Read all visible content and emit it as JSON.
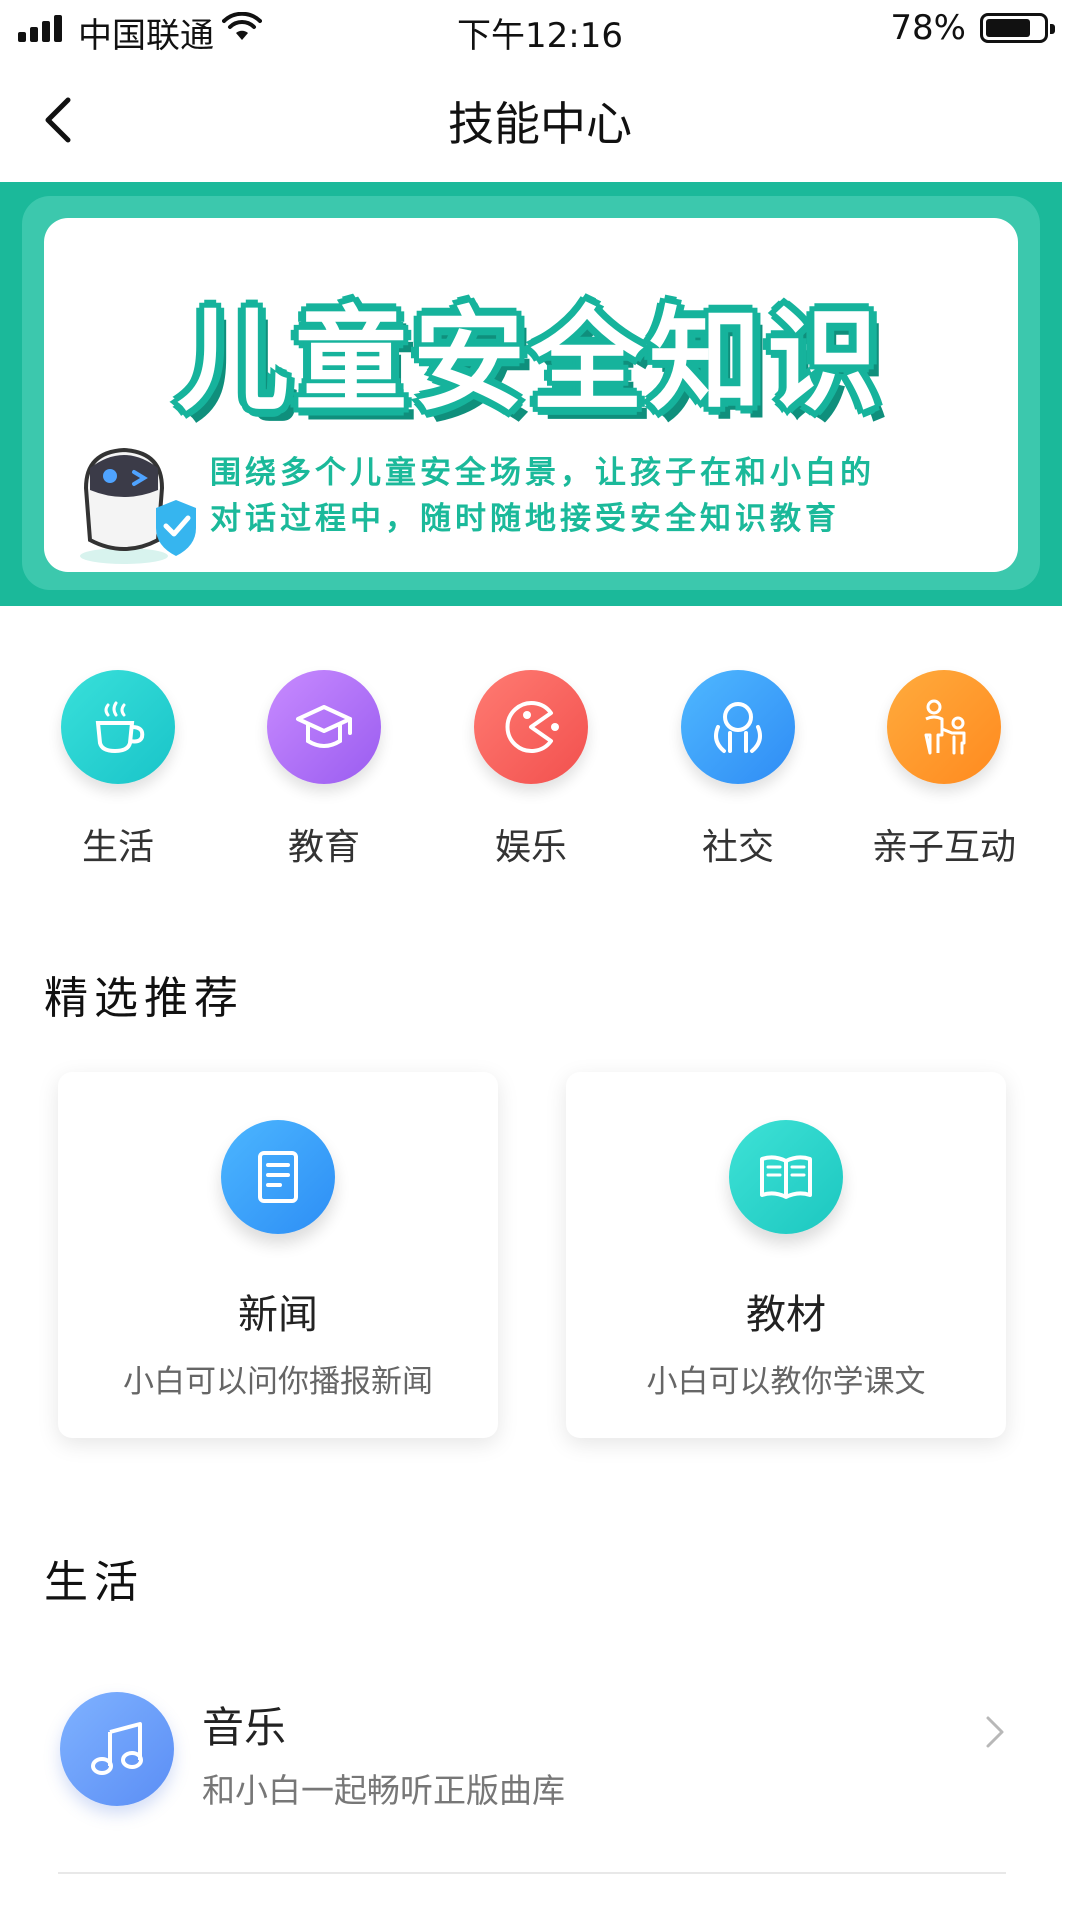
{
  "status_bar": {
    "carrier": "中国联通",
    "time": "下午12:16",
    "battery_percent": "78%",
    "battery_level": 0.78
  },
  "nav": {
    "title": "技能中心",
    "back_icon": "chevron-left-icon"
  },
  "banner": {
    "title": "儿童安全知识",
    "subtitle_line1": "围绕多个儿童安全场景，让孩子在和小白的",
    "subtitle_line2": "对话过程中，随时随地接受安全知识教育",
    "colors": {
      "background": "#1bb99a",
      "title_outline": "#16b39c"
    }
  },
  "categories": [
    {
      "label": "生活",
      "icon": "coffee-cup-icon",
      "colors": [
        "#39e0da",
        "#19c4c9"
      ]
    },
    {
      "label": "教育",
      "icon": "graduation-cap-icon",
      "colors": [
        "#c88bff",
        "#9a5cf0"
      ]
    },
    {
      "label": "娱乐",
      "icon": "pacman-icon",
      "colors": [
        "#ff7b72",
        "#f2504e"
      ]
    },
    {
      "label": "社交",
      "icon": "people-icon",
      "colors": [
        "#4fb8ff",
        "#2f8cf5"
      ]
    },
    {
      "label": "亲子互动",
      "icon": "parent-child-icon",
      "colors": [
        "#ffab3d",
        "#ff8a1f"
      ]
    }
  ],
  "featured": {
    "title": "精选推荐",
    "items": [
      {
        "title": "新闻",
        "desc": "小白可以问你播报新闻",
        "icon": "document-icon",
        "colors": [
          "#4cb6ff",
          "#2d8ef5"
        ]
      },
      {
        "title": "教材",
        "desc": "小白可以教你学课文",
        "icon": "book-icon",
        "colors": [
          "#3ee2d6",
          "#1cc7c0"
        ]
      }
    ]
  },
  "life_section": {
    "title": "生活",
    "items": [
      {
        "title": "音乐",
        "desc": "和小白一起畅听正版曲库",
        "icon": "music-note-icon"
      }
    ]
  }
}
